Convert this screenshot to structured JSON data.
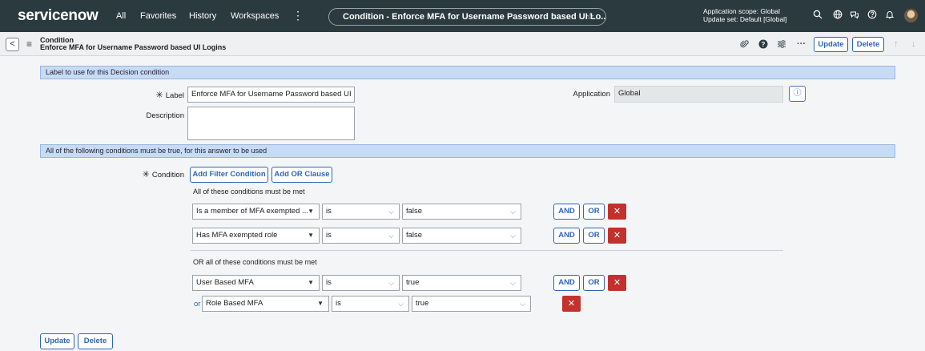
{
  "topnav": {
    "logo": "servicenow",
    "items": [
      "All",
      "Favorites",
      "History",
      "Workspaces"
    ],
    "more": "⋮",
    "title": "Condition - Enforce MFA for Username Password based UI Lo...",
    "star": "☆",
    "scope_line1": "Application scope: Global",
    "scope_line2": "Update set: Default [Global]"
  },
  "formhead": {
    "back": "<",
    "menu": "≡",
    "title_line1": "Condition",
    "title_line2": "Enforce MFA for Username Password based UI Logins",
    "update_label": "Update",
    "delete_label": "Delete",
    "more": "···"
  },
  "section1": {
    "header": "Label to use for this Decision condition",
    "label_label": "Label",
    "label_value": "Enforce MFA for Username Password based UI Lo",
    "description_label": "Description",
    "description_value": "",
    "application_label": "Application",
    "application_value": "Global",
    "info_glyph": "ⓘ"
  },
  "section2": {
    "header": "All of the following conditions must be true, for this answer to be used",
    "condition_label": "Condition",
    "add_filter_label": "Add Filter Condition",
    "add_or_label": "Add OR Clause",
    "group1_heading": "All of these conditions must be met",
    "group1_rows": [
      {
        "field": "Is a member of MFA exempted ...",
        "operator": "is",
        "value": "false"
      },
      {
        "field": "Has MFA exempted role",
        "operator": "is",
        "value": "false"
      }
    ],
    "group2_heading": "OR all of these conditions must be met",
    "group2_rows": [
      {
        "field": "User Based MFA",
        "operator": "is",
        "value": "true"
      },
      {
        "prefix": "or",
        "field": "Role Based MFA",
        "operator": "is",
        "value": "true"
      }
    ],
    "and_label": "AND",
    "or_label": "OR",
    "remove_glyph": "✕"
  },
  "footer": {
    "update_label": "Update",
    "delete_label": "Delete"
  },
  "colors": {
    "nav_bg": "#2b3a3f",
    "accent_blue": "#2e65b8",
    "section_blue": "#c8dbf5",
    "delete_red": "#c4302b"
  }
}
